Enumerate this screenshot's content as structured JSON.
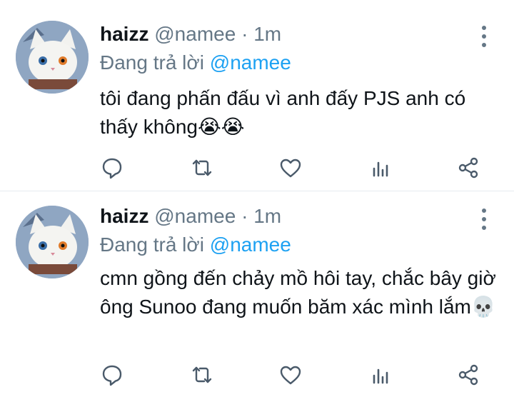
{
  "colors": {
    "mention": "#1da1f2",
    "meta": "#657786",
    "text": "#0f1419",
    "divider": "#e6ecf0"
  },
  "tweets": [
    {
      "display_name": "haizz",
      "handle": "@namee",
      "separator": " · ",
      "time": "1m",
      "reply_prefix": "Đang trả lời ",
      "reply_to": "@namee",
      "text": "tôi đang phấn đấu vì anh đấy PJS anh có thấy không",
      "emoji": "😭😭",
      "avatar_icon": "cat-avatar-icon"
    },
    {
      "display_name": "haizz",
      "handle": "@namee",
      "separator": " · ",
      "time": "1m",
      "reply_prefix": "Đang trả lời ",
      "reply_to": "@namee",
      "text": "cmn gồng đến chảy mồ hôi tay, chắc bây giờ ông Sunoo đang muốn băm xác mình lắm",
      "emoji": "💀",
      "avatar_icon": "cat-avatar-icon"
    }
  ],
  "action_icons": [
    "reply-icon",
    "retweet-icon",
    "like-icon",
    "views-icon",
    "share-icon"
  ]
}
